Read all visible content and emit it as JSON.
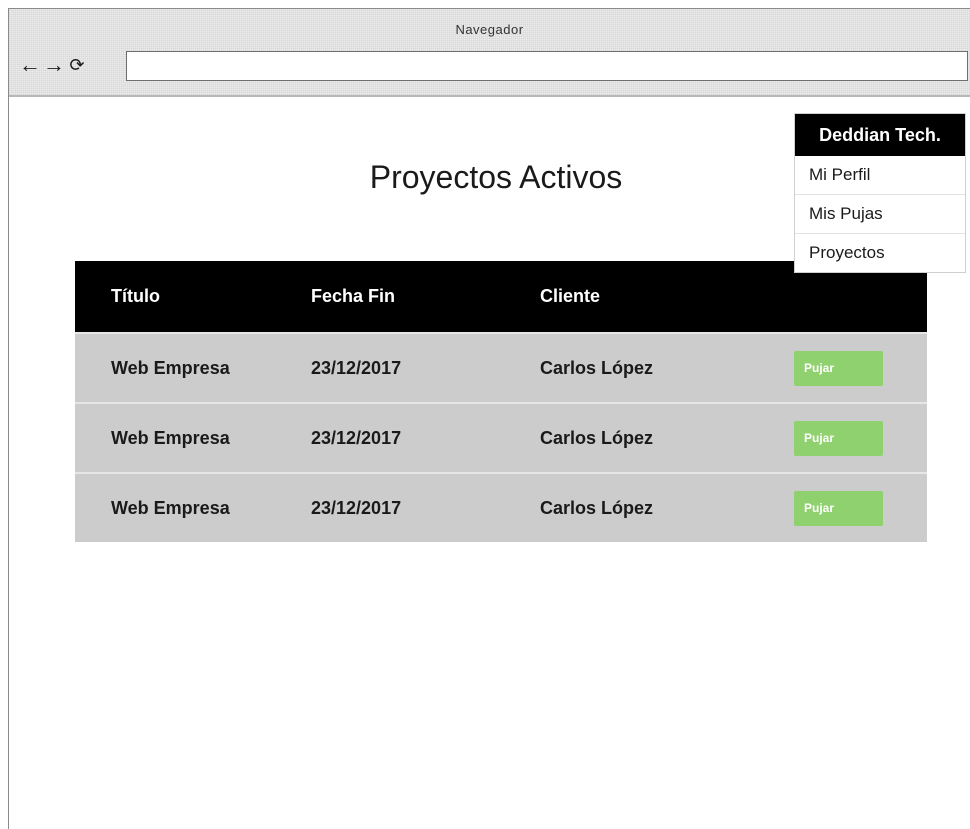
{
  "window": {
    "title": "Navegador"
  },
  "toolbar": {
    "back_icon": "←",
    "forward_icon": "→",
    "refresh_icon": "⟳",
    "address_value": ""
  },
  "page": {
    "title": "Proyectos Activos"
  },
  "table": {
    "headers": [
      "Título",
      "Fecha Fin",
      "Cliente",
      ""
    ],
    "rows": [
      {
        "titulo": "Web Empresa",
        "fecha": "23/12/2017",
        "cliente": "Carlos López",
        "accion": "Pujar"
      },
      {
        "titulo": "Web Empresa",
        "fecha": "23/12/2017",
        "cliente": "Carlos López",
        "accion": "Pujar"
      },
      {
        "titulo": "Web Empresa",
        "fecha": "23/12/2017",
        "cliente": "Carlos López",
        "accion": "Pujar"
      }
    ]
  },
  "menu": {
    "header": "Deddian Tech.",
    "items": [
      "Mi Perfil",
      "Mis Pujas",
      "Proyectos"
    ]
  },
  "colors": {
    "header_bg": "#000000",
    "row_bg": "#cccccc",
    "bid_button": "#8fd16e"
  }
}
